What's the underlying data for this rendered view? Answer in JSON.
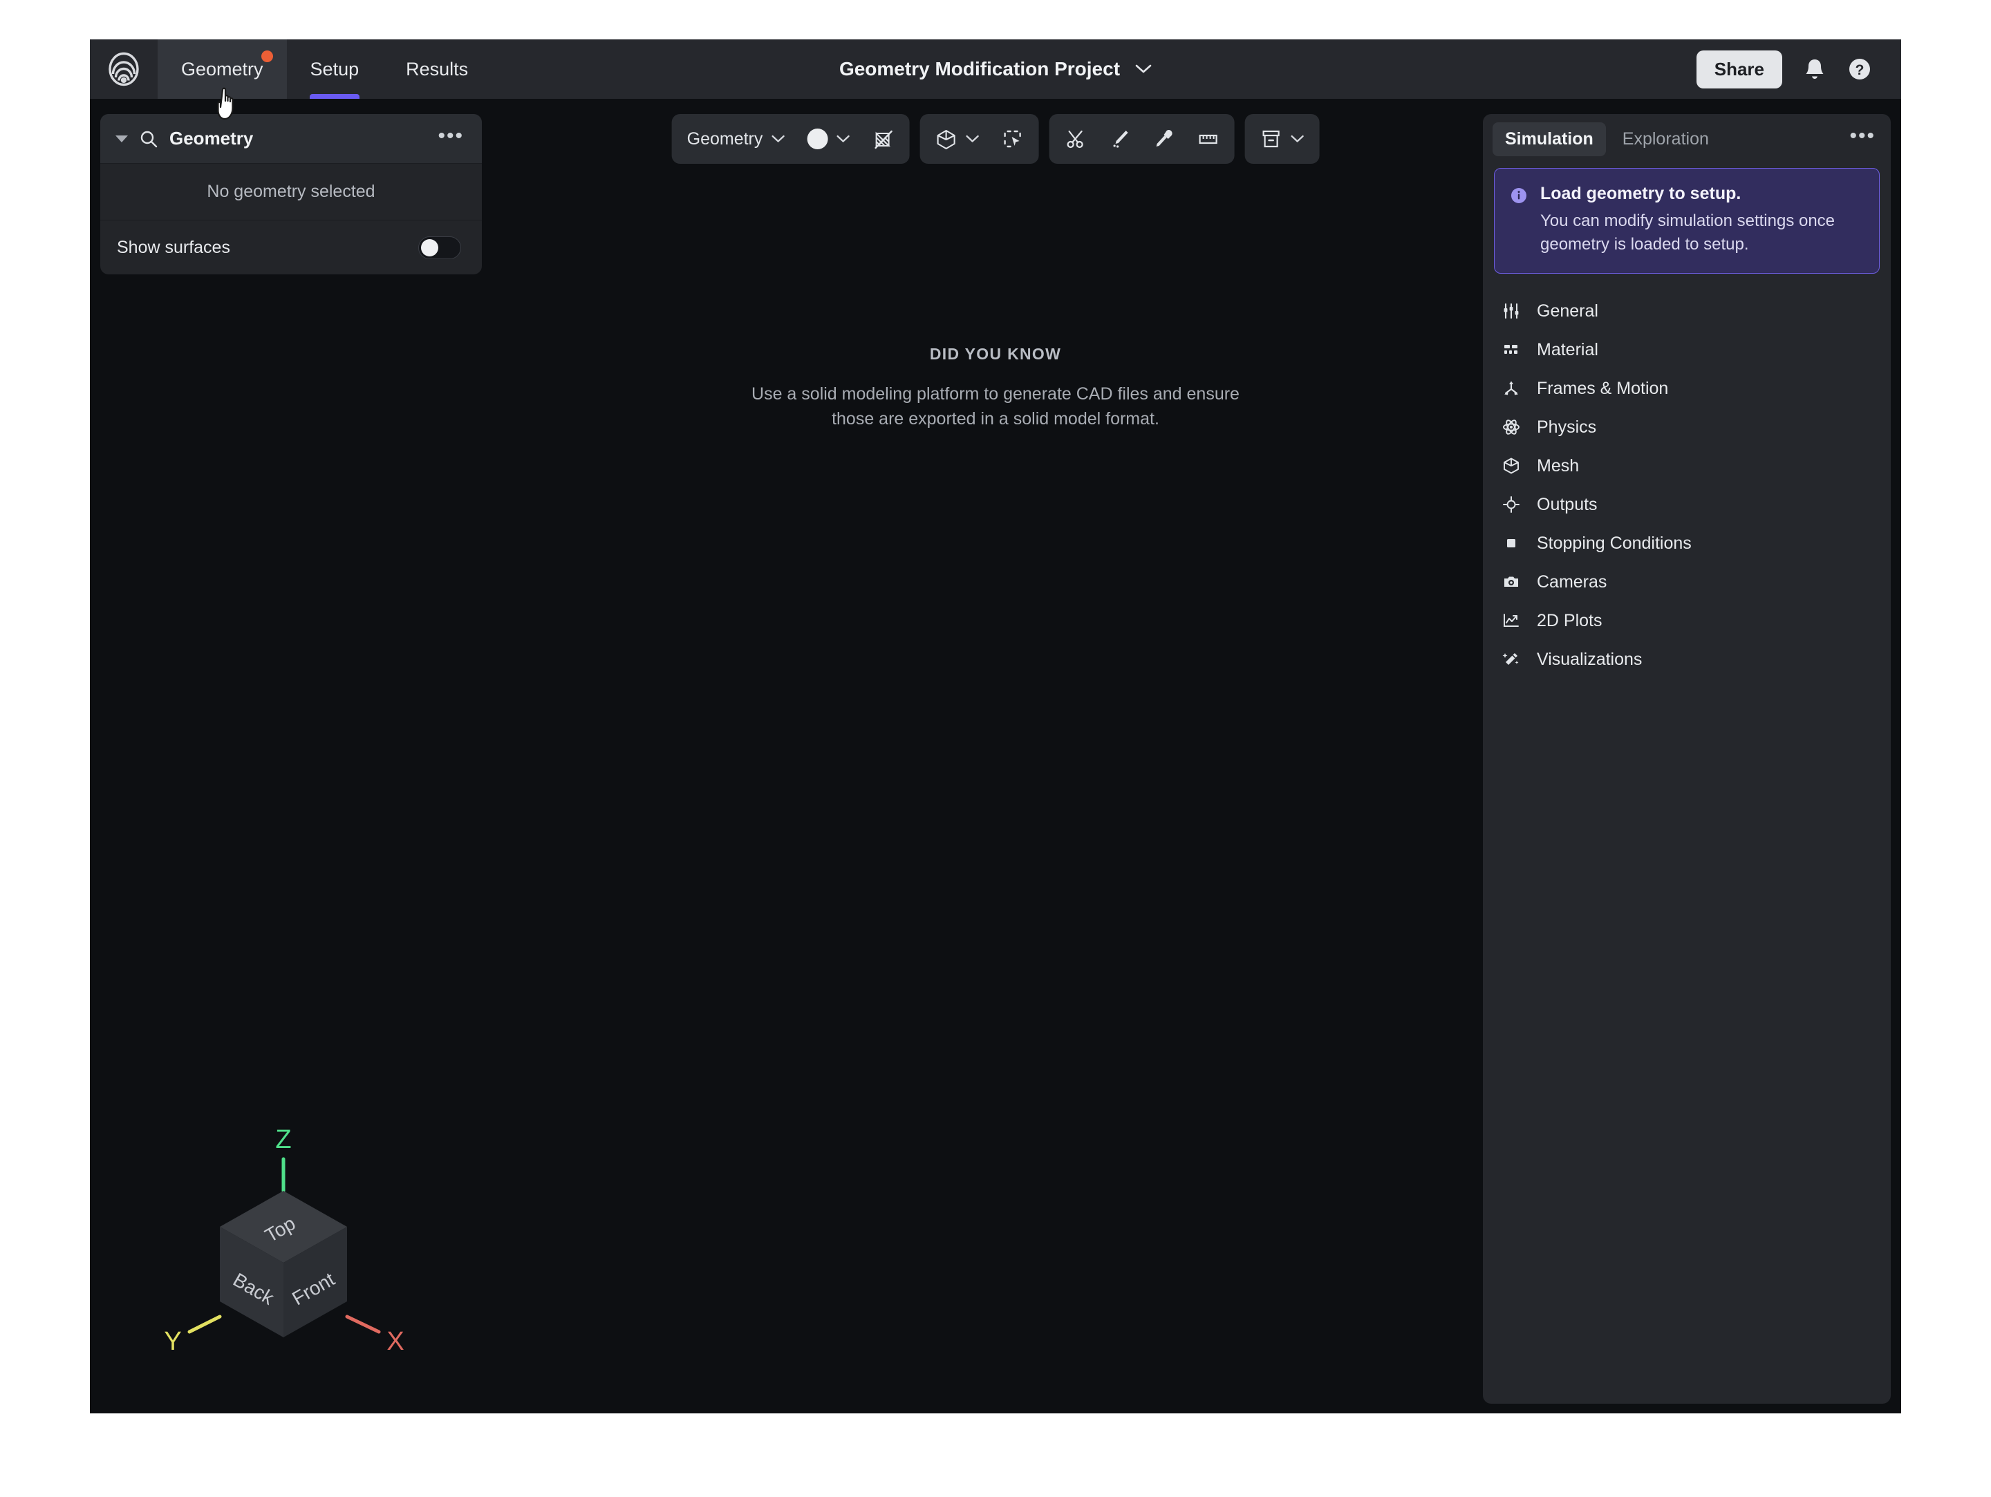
{
  "header": {
    "logo_icon": "luminary-rings-logo",
    "tabs": [
      {
        "label": "Geometry",
        "state": "hovered",
        "badge": true
      },
      {
        "label": "Setup",
        "state": "active"
      },
      {
        "label": "Results",
        "state": "default"
      }
    ],
    "project_title": "Geometry Modification Project",
    "project_caret_icon": "chevron-down-icon",
    "share_label": "Share",
    "bell_icon": "notification-bell-icon",
    "help_icon": "help-circle-icon"
  },
  "geometry_panel": {
    "collapse_icon": "caret-down-icon",
    "search_icon": "search-icon",
    "title": "Geometry",
    "more_icon": "ellipsis-icon",
    "empty_text": "No geometry selected",
    "toggle_label": "Show surfaces",
    "toggle_state": "off"
  },
  "toolbar": {
    "groups": [
      {
        "items": [
          {
            "type": "dropdown",
            "label": "Geometry",
            "icon": "chevron-down-icon",
            "name": "geometry-mode-dropdown"
          },
          {
            "type": "swatch",
            "icon": "color-swatch-icon",
            "name": "display-color-dropdown"
          },
          {
            "type": "icon",
            "icon": "mesh-off-icon",
            "name": "toggle-mesh-button"
          }
        ]
      },
      {
        "items": [
          {
            "type": "dropdown-icon",
            "icon": "cube-icon",
            "name": "render-style-dropdown"
          },
          {
            "type": "icon",
            "icon": "box-select-icon",
            "name": "box-select-button"
          }
        ]
      },
      {
        "items": [
          {
            "type": "icon",
            "icon": "scissors-icon",
            "name": "cut-tool-button"
          },
          {
            "type": "icon",
            "icon": "knife-icon",
            "name": "knife-tool-button"
          },
          {
            "type": "icon",
            "icon": "eyedropper-icon",
            "name": "eyedropper-tool-button"
          },
          {
            "type": "icon",
            "icon": "ruler-icon",
            "name": "measure-tool-button"
          }
        ]
      },
      {
        "items": [
          {
            "type": "dropdown-icon",
            "icon": "archive-box-icon",
            "name": "archive-dropdown"
          }
        ]
      }
    ]
  },
  "viewport": {
    "hint_kicker": "DID YOU KNOW",
    "hint_body": "Use a solid modeling platform to generate CAD files and ensure those are exported in a solid model format.",
    "orientation_cube": {
      "faces": {
        "top": "Top",
        "left": "Back",
        "right": "Front"
      },
      "axes": [
        {
          "label": "Z",
          "color": "#4fe08a"
        },
        {
          "label": "Y",
          "color": "#e2e061"
        },
        {
          "label": "X",
          "color": "#e06a60"
        }
      ]
    }
  },
  "right_panel": {
    "tabs": [
      {
        "label": "Simulation",
        "state": "active"
      },
      {
        "label": "Exploration",
        "state": "default"
      }
    ],
    "more_icon": "ellipsis-icon",
    "banner": {
      "icon": "info-circle-icon",
      "title": "Load geometry to setup.",
      "body": "You can modify simulation settings once geometry is loaded to setup.",
      "accent_color": "#6d5de0",
      "background_color": "#322d5e"
    },
    "menu": [
      {
        "label": "General",
        "icon": "sliders-icon"
      },
      {
        "label": "Material",
        "icon": "material-grid-icon"
      },
      {
        "label": "Frames & Motion",
        "icon": "axes-tripod-icon"
      },
      {
        "label": "Physics",
        "icon": "atom-icon"
      },
      {
        "label": "Mesh",
        "icon": "cube-icon"
      },
      {
        "label": "Outputs",
        "icon": "target-icon"
      },
      {
        "label": "Stopping Conditions",
        "icon": "square-icon"
      },
      {
        "label": "Cameras",
        "icon": "camera-icon"
      },
      {
        "label": "2D Plots",
        "icon": "line-chart-icon"
      },
      {
        "label": "Visualizations",
        "icon": "magic-wand-icon"
      }
    ]
  },
  "cursor": {
    "icon": "pointing-hand-cursor"
  }
}
